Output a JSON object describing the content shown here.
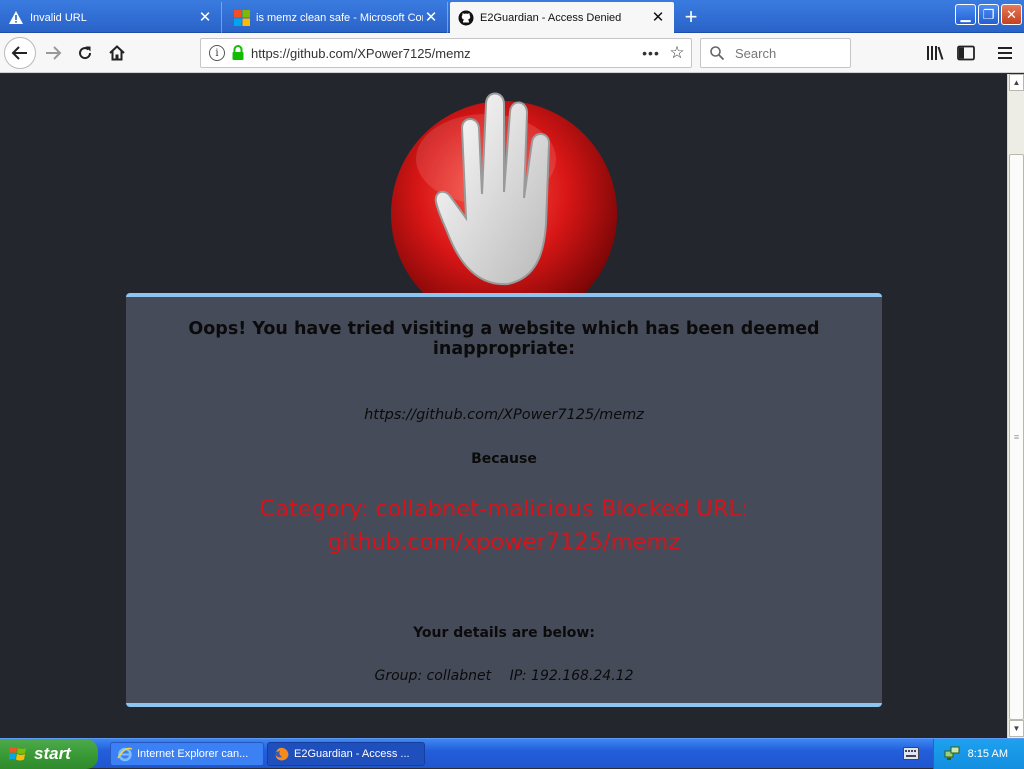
{
  "browser": {
    "tabs": [
      {
        "label": "Invalid URL",
        "icon": "warning-icon",
        "active": false
      },
      {
        "label": "is memz clean safe - Microsoft Com",
        "icon": "microsoft-icon",
        "active": false
      },
      {
        "label": "E2Guardian - Access Denied",
        "icon": "github-icon",
        "active": true
      }
    ],
    "url": "https://github.com/XPower7125/memz",
    "search_placeholder": "Search"
  },
  "page": {
    "headline": "Oops! You have tried visiting a website which has been deemed inappropriate:",
    "blocked_url": "https://github.com/XPower7125/memz",
    "because_label": "Because",
    "reason": "Category: collabnet-malicious  Blocked URL: github.com/xpower7125/memz",
    "details_label": "Your details are below:",
    "group": "Group: collabnet",
    "ip": "IP: 192.168.24.12"
  },
  "taskbar": {
    "start_label": "start",
    "items": [
      {
        "label": "Internet Explorer can...",
        "active": false
      },
      {
        "label": "E2Guardian - Access ...",
        "active": true
      }
    ],
    "clock": "8:15 AM"
  },
  "colors": {
    "page_bg": "#24262d",
    "panel_bg": "#464b59",
    "panel_border": "#8ec5f0",
    "reason_text": "#d4141a",
    "stop_red": "#d81616"
  }
}
